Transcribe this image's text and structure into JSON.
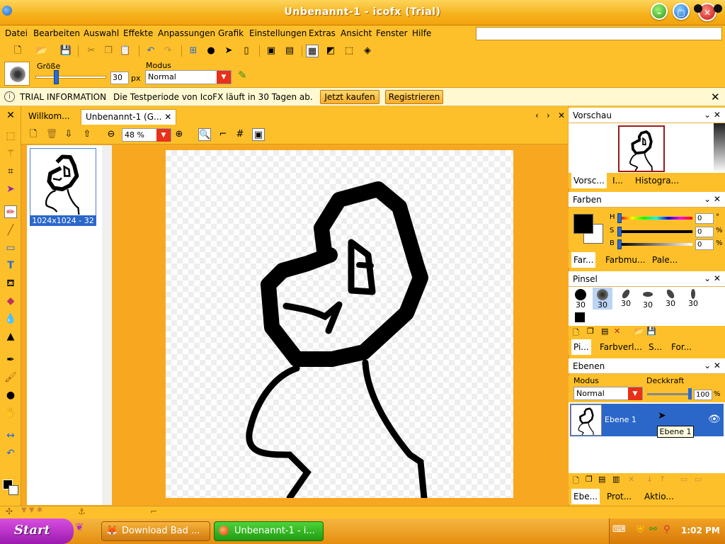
{
  "window": {
    "title": "Unbenannt-1 - icofx (Trial)"
  },
  "menu": [
    "Datei",
    "Bearbeiten",
    "Auswahl",
    "Effekte",
    "Anpassungen",
    "Grafik",
    "Einstellungen",
    "Extras",
    "Ansicht",
    "Fenster",
    "Hilfe"
  ],
  "options": {
    "size_label": "Größe",
    "size_value": "30",
    "size_unit": "px",
    "mode_label": "Modus",
    "mode_value": "Normal"
  },
  "trial": {
    "title": "TRIAL INFORMATION",
    "message": "Die Testperiode von IcoFX läuft in 30 Tagen ab.",
    "buy_label": "Jetzt kaufen",
    "register_label": "Registrieren"
  },
  "doc": {
    "tabs": [
      "Willkom...",
      "Unbenannt-1 (G..."
    ],
    "zoom": "48 %",
    "thumb_caption": "1024x1024 - 32"
  },
  "panels": {
    "preview": {
      "title": "Vorschau",
      "tabs": [
        "Vorsc...",
        "I...",
        "Histogra..."
      ]
    },
    "colors": {
      "title": "Farben",
      "h_label": "H",
      "s_label": "S",
      "b_label": "B",
      "h_value": "0",
      "s_value": "0",
      "b_value": "0",
      "h_unit": "°",
      "s_unit": "%",
      "b_unit": "%",
      "tabs": [
        "Far...",
        "Farbmu...",
        "Pale..."
      ]
    },
    "brush": {
      "title": "Pinsel",
      "sizes": [
        "30",
        "30",
        "30",
        "30",
        "30",
        "30"
      ],
      "tabs": [
        "Pi...",
        "Farbverl...",
        "S...",
        "For..."
      ]
    },
    "layers": {
      "title": "Ebenen",
      "mode_label": "Modus",
      "opacity_label": "Deckkraft",
      "mode_value": "Normal",
      "opacity_value": "100",
      "opacity_unit": "%",
      "layer_name": "Ebene 1",
      "tooltip": "Ebene 1",
      "tabs": [
        "Ebe...",
        "Prot...",
        "Aktio..."
      ]
    }
  },
  "taskbar": {
    "start_label": "Start",
    "tasks": [
      "Download Bad ...",
      "Unbenannt-1 - i..."
    ],
    "clock": "1:02 PM"
  },
  "colors": {
    "title_bg": "#f6b11a",
    "ui_bg": "#fdc02a",
    "selection": "#2b67c9",
    "start": "#b62ec8"
  }
}
